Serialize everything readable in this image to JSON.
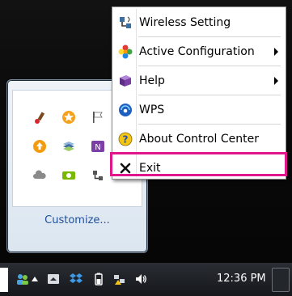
{
  "menu": {
    "items": [
      {
        "label": "Wireless Setting",
        "icon": "network-cable-icon",
        "submenu": false
      },
      {
        "label": "Active Configuration",
        "icon": "colorful-flower-icon",
        "submenu": true
      },
      {
        "label": "Help",
        "icon": "book-icon",
        "submenu": true
      },
      {
        "label": "WPS",
        "icon": "wps-globe-icon",
        "submenu": false
      },
      {
        "label": "About Control Center",
        "icon": "question-mark-icon",
        "submenu": false
      },
      {
        "label": "Exit",
        "icon": "close-x-icon",
        "submenu": false
      }
    ],
    "highlight_color": "#e0168a"
  },
  "tray_panel": {
    "customize_label": "Customize..."
  },
  "taskbar": {
    "clock": "12:36 PM"
  }
}
